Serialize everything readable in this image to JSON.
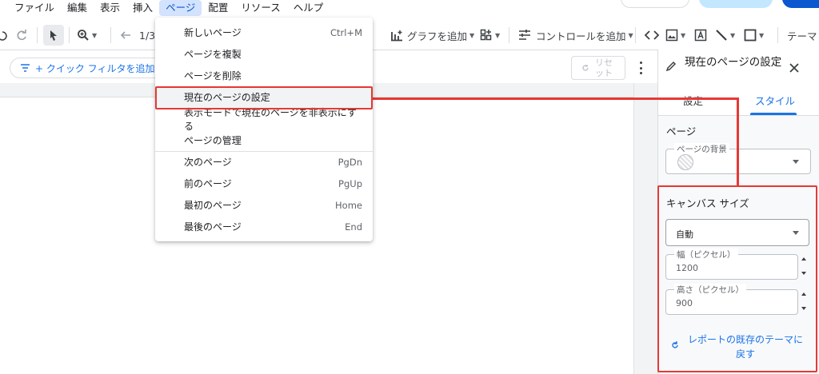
{
  "menubar": {
    "items": [
      "ファイル",
      "編集",
      "表示",
      "挿入",
      "ページ",
      "配置",
      "リソース",
      "ヘルプ"
    ],
    "active": "ページ"
  },
  "toolbar": {
    "page_indicator": "1/3",
    "add_chart": "グラフを追加",
    "add_control": "コントロールを追加",
    "theme": "テーマ"
  },
  "filterbar": {
    "quick_filter": "+ クイック フィルタを追加",
    "reset": "リセット"
  },
  "page_menu": {
    "items": [
      {
        "label": "新しいページ",
        "shortcut": "Ctrl+M"
      },
      {
        "label": "ページを複製",
        "shortcut": ""
      },
      {
        "label": "ページを削除",
        "shortcut": ""
      },
      {
        "label": "現在のページの設定",
        "shortcut": ""
      },
      {
        "label": "表示モードで現在のページを非表示にする",
        "shortcut": ""
      },
      {
        "label": "ページの管理",
        "shortcut": ""
      },
      {
        "label": "次のページ",
        "shortcut": "PgDn"
      },
      {
        "label": "前のページ",
        "shortcut": "PgUp"
      },
      {
        "label": "最初のページ",
        "shortcut": "Home"
      },
      {
        "label": "最後のページ",
        "shortcut": "End"
      }
    ],
    "highlighted_index": 3
  },
  "panel": {
    "title": "現在のページの設定",
    "tabs": [
      "設定",
      "スタイル"
    ],
    "active_tab": "スタイル",
    "page_section": {
      "title": "ページ",
      "background_label": "ページの背景"
    },
    "canvas_section": {
      "title": "キャンバス サイズ",
      "size_mode": "自動",
      "width_label": "幅（ピクセル）",
      "width_value": "1200",
      "height_label": "高さ（ピクセル）",
      "height_value": "900"
    },
    "reset_theme": "レポートの既存のテーマに戻す"
  },
  "colors": {
    "accent": "#1a73e8",
    "highlight_box": "#e53935",
    "active_menu_bg": "#d3e3fd"
  }
}
